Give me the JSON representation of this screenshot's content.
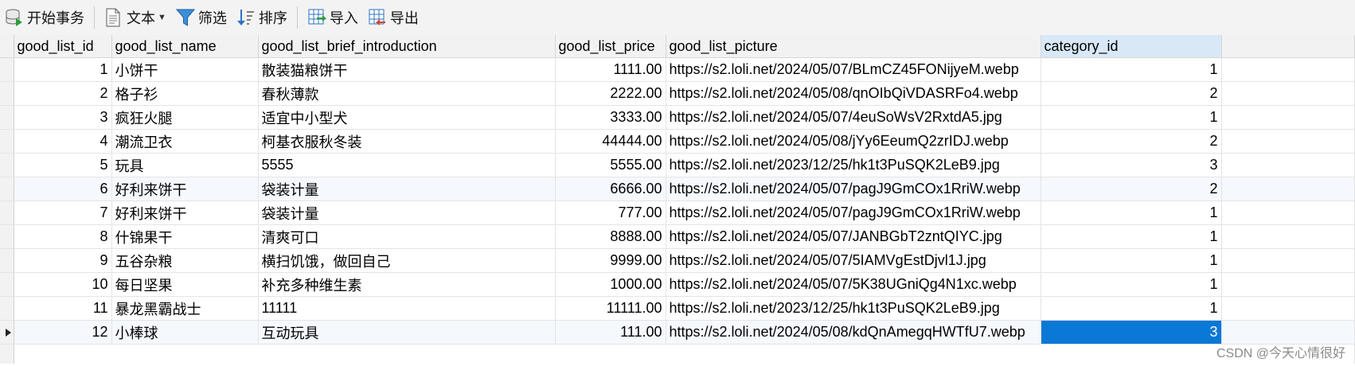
{
  "toolbar": {
    "begin_transaction": "开始事务",
    "text": "文本",
    "filter": "筛选",
    "sort": "排序",
    "import": "导入",
    "export": "导出"
  },
  "columns": [
    "good_list_id",
    "good_list_name",
    "good_list_brief_introduction",
    "good_list_price",
    "good_list_picture",
    "category_id"
  ],
  "rows": [
    {
      "id": "1",
      "name": "小饼干",
      "intro": "散装猫粮饼干",
      "price": "1111.00",
      "picture": "https://s2.loli.net/2024/05/07/BLmCZ45FONijyeM.webp",
      "category": "1"
    },
    {
      "id": "2",
      "name": "格子衫",
      "intro": "春秋薄款",
      "price": "2222.00",
      "picture": "https://s2.loli.net/2024/05/08/qnOIbQiVDASRFo4.webp",
      "category": "2"
    },
    {
      "id": "3",
      "name": "疯狂火腿",
      "intro": "适宜中小型犬",
      "price": "3333.00",
      "picture": "https://s2.loli.net/2024/05/07/4euSoWsV2RxtdA5.jpg",
      "category": "1"
    },
    {
      "id": "4",
      "name": "潮流卫衣",
      "intro": "柯基衣服秋冬装",
      "price": "44444.00",
      "picture": "https://s2.loli.net/2024/05/08/jYy6EeumQ2zrIDJ.webp",
      "category": "2"
    },
    {
      "id": "5",
      "name": "玩具",
      "intro": "5555",
      "price": "5555.00",
      "picture": "https://s2.loli.net/2023/12/25/hk1t3PuSQK2LeB9.jpg",
      "category": "3"
    },
    {
      "id": "6",
      "name": "好利来饼干",
      "intro": "袋装计量",
      "price": "6666.00",
      "picture": "https://s2.loli.net/2024/05/07/pagJ9GmCOx1RriW.webp",
      "category": "2"
    },
    {
      "id": "7",
      "name": "好利来饼干",
      "intro": "袋装计量",
      "price": "777.00",
      "picture": "https://s2.loli.net/2024/05/07/pagJ9GmCOx1RriW.webp",
      "category": "1"
    },
    {
      "id": "8",
      "name": "什锦果干",
      "intro": "清爽可口",
      "price": "8888.00",
      "picture": "https://s2.loli.net/2024/05/07/JANBGbT2zntQIYC.jpg",
      "category": "1"
    },
    {
      "id": "9",
      "name": "五谷杂粮",
      "intro": "横扫饥饿，做回自己",
      "price": "9999.00",
      "picture": "https://s2.loli.net/2024/05/07/5IAMVgEstDjvl1J.jpg",
      "category": "1"
    },
    {
      "id": "10",
      "name": "每日坚果",
      "intro": "补充多种维生素",
      "price": "1000.00",
      "picture": "https://s2.loli.net/2024/05/07/5K38UGniQg4N1xc.webp",
      "category": "1"
    },
    {
      "id": "11",
      "name": "暴龙黑霸战士",
      "intro": "11111",
      "price": "11111.00",
      "picture": "https://s2.loli.net/2023/12/25/hk1t3PuSQK2LeB9.jpg",
      "category": "1"
    },
    {
      "id": "12",
      "name": "小棒球",
      "intro": "互动玩具",
      "price": "111.00",
      "picture": "https://s2.loli.net/2024/05/08/kdQnAmegqHWTfU7.webp",
      "category": "3"
    }
  ],
  "watermark": "CSDN @今天心情很好",
  "colors": {
    "accent": "#0a78d7",
    "header_bg": "#f2f2f2",
    "selected_header": "#d8e8f7",
    "alt_row": "#f5f8fc"
  }
}
